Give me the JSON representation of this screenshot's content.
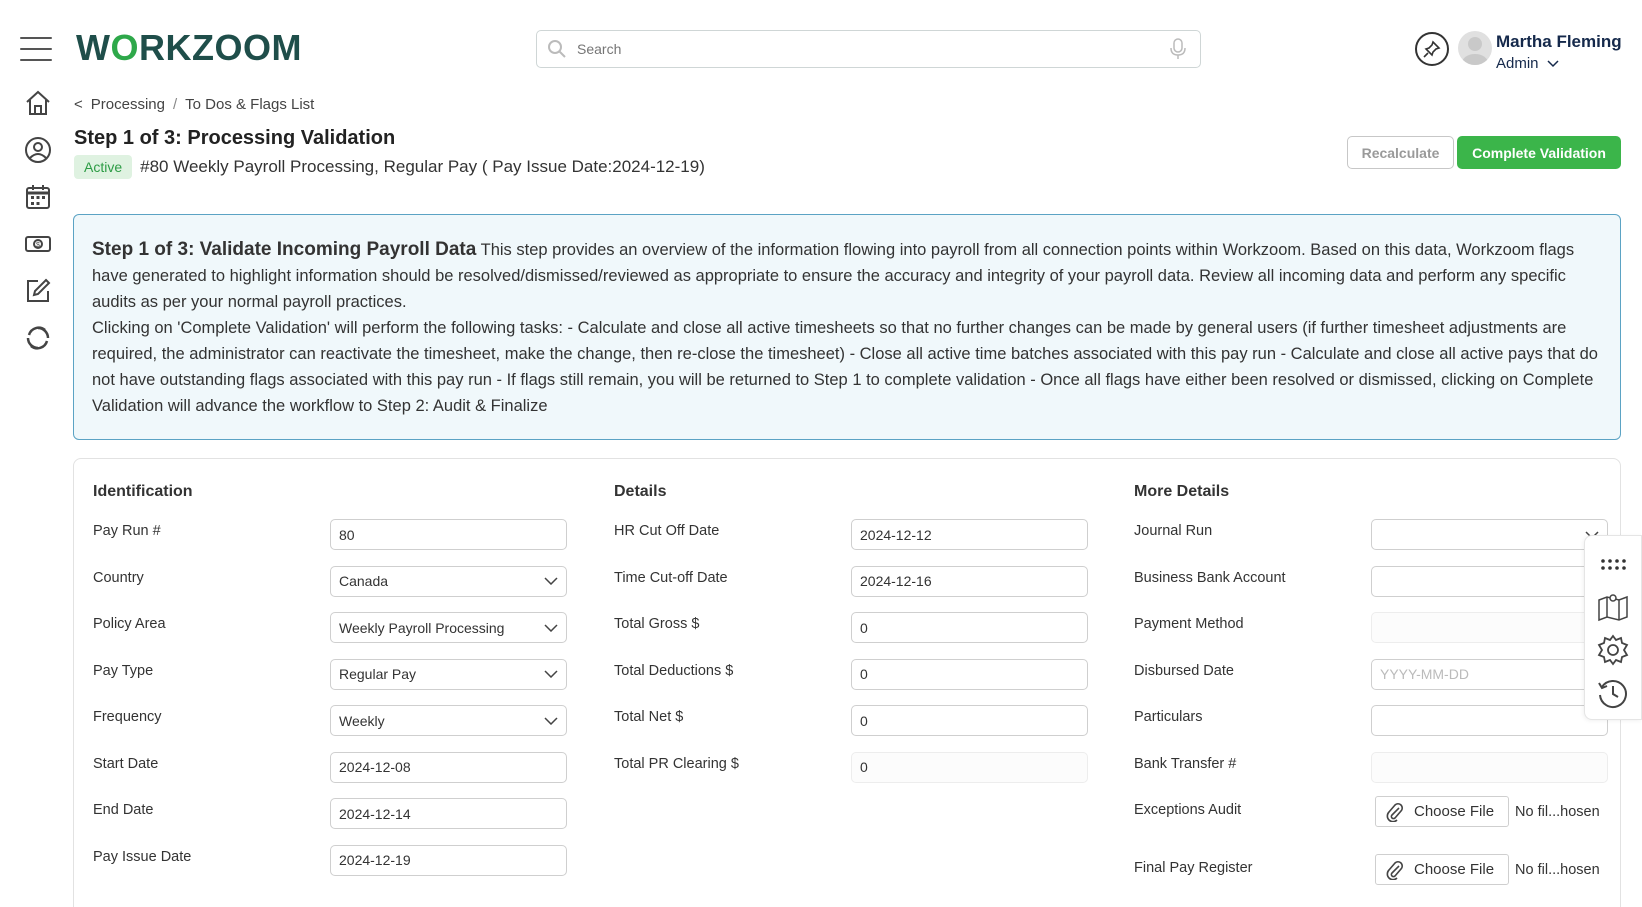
{
  "header": {
    "logo_text": "WORKZOOM",
    "search_placeholder": "Search",
    "user_name": "Martha Fleming",
    "user_role": "Admin"
  },
  "nav_icons": [
    "home-icon",
    "user-circle-icon",
    "calendar-icon",
    "money-icon",
    "edit-icon",
    "cycle-icon"
  ],
  "breadcrumb": {
    "back": "<",
    "item1": "Processing",
    "separator": "/",
    "item2": "To Dos & Flags List"
  },
  "page": {
    "title": "Step 1 of 3: Processing Validation",
    "status": "Active",
    "run_description": "#80 Weekly Payroll Processing, Regular Pay ( Pay Issue Date:2024-12-19)"
  },
  "actions": {
    "recalculate": "Recalculate",
    "complete_validation": "Complete Validation"
  },
  "info": {
    "title": "Step 1 of 3: Validate Incoming Payroll Data",
    "body1": " This step provides an overview of the information flowing into payroll from all connection points within Workzoom. Based on this data, Workzoom flags have generated to highlight information should be resolved/dismissed/reviewed as appropriate to ensure the accuracy and integrity of your payroll data. Review all incoming data and perform any specific audits as per your normal payroll practices.",
    "body2": "Clicking on 'Complete Validation' will perform the following tasks: - Calculate and close all active timesheets so that no further changes can be made by general users (if further timesheet adjustments are required, the administrator can reactivate the timesheet, make the change, then re-close the timesheet) - Close all active time batches associated with this pay run - Calculate and close all active pays that do not have outstanding flags associated with this pay run - If flags still remain, you will be returned to Step 1 to complete validation - Once all flags have either been resolved or dismissed, clicking on Complete Validation will advance the workflow to Step 2: Audit & Finalize"
  },
  "identification": {
    "title": "Identification",
    "pay_run_label": "Pay Run #",
    "pay_run_value": "80",
    "country_label": "Country",
    "country_value": "Canada",
    "policy_label": "Policy Area",
    "policy_value": "Weekly Payroll Processing",
    "pay_type_label": "Pay Type",
    "pay_type_value": "Regular Pay",
    "frequency_label": "Frequency",
    "frequency_value": "Weekly",
    "start_label": "Start Date",
    "start_value": "2024-12-08",
    "end_label": "End Date",
    "end_value": "2024-12-14",
    "issue_label": "Pay Issue Date",
    "issue_value": "2024-12-19"
  },
  "details": {
    "title": "Details",
    "hr_cutoff_label": "HR Cut Off Date",
    "hr_cutoff_value": "2024-12-12",
    "time_cutoff_label": "Time Cut-off Date",
    "time_cutoff_value": "2024-12-16",
    "gross_label": "Total Gross $",
    "gross_value": "0",
    "deductions_label": "Total Deductions $",
    "deductions_value": "0",
    "net_label": "Total Net $",
    "net_value": "0",
    "clearing_label": "Total PR Clearing $",
    "clearing_value": "0"
  },
  "more_details": {
    "title": "More Details",
    "journal_label": "Journal Run",
    "journal_value": "",
    "bank_account_label": "Business Bank Account",
    "bank_account_value": "",
    "payment_method_label": "Payment Method",
    "payment_method_value": "",
    "disbursed_label": "Disbursed Date",
    "disbursed_placeholder": "YYYY-MM-DD",
    "particulars_label": "Particulars",
    "particulars_value": "",
    "bank_transfer_label": "Bank Transfer #",
    "bank_transfer_value": "",
    "exceptions_label": "Exceptions Audit",
    "final_register_label": "Final Pay Register",
    "choose_file": "Choose File",
    "no_file": "No fil...hosen"
  },
  "float_tools": [
    "grid-dots-icon",
    "map-icon",
    "gear-icon",
    "history-icon"
  ]
}
